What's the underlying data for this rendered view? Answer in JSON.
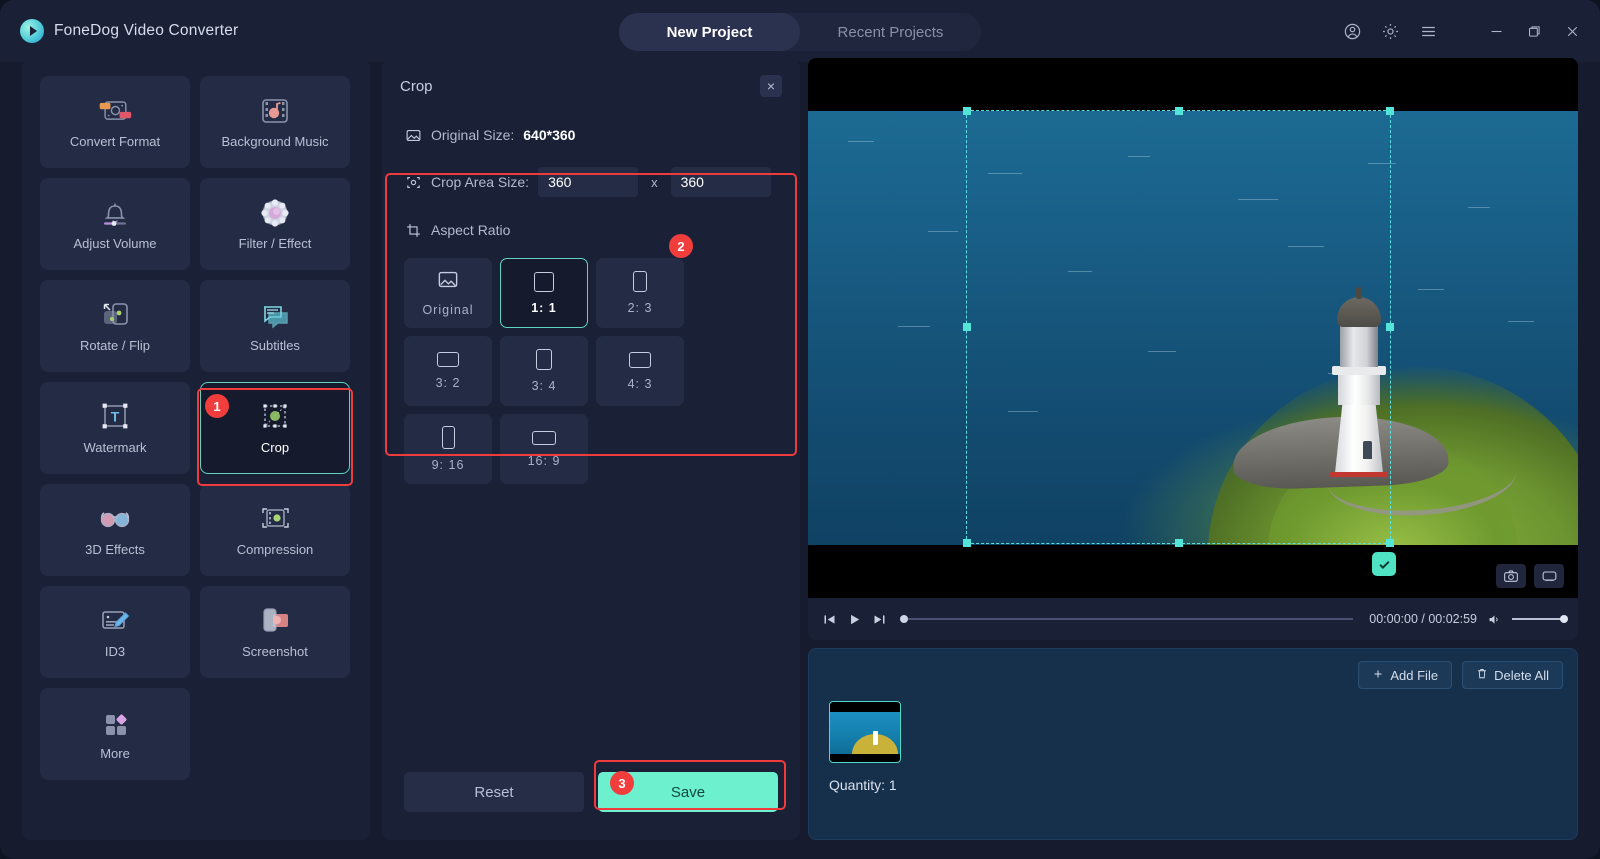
{
  "app": {
    "brand": "FoneDog Video Converter",
    "logo_icon": "play-circle-icon"
  },
  "header": {
    "tabs": [
      {
        "label": "New Project",
        "active": true
      },
      {
        "label": "Recent Projects",
        "active": false
      }
    ],
    "icons": [
      {
        "name": "account-icon"
      },
      {
        "name": "gear-icon"
      },
      {
        "name": "menu-icon"
      },
      {
        "name": "minimize-icon"
      },
      {
        "name": "maximize-icon"
      },
      {
        "name": "close-icon"
      }
    ]
  },
  "sidebar": {
    "tools": [
      {
        "label": "Convert Format",
        "icon": "convert-format-icon",
        "selected": false
      },
      {
        "label": "Background Music",
        "icon": "background-music-icon",
        "selected": false
      },
      {
        "label": "Adjust Volume",
        "icon": "adjust-volume-icon",
        "selected": false
      },
      {
        "label": "Filter / Effect",
        "icon": "filter-effect-icon",
        "selected": false
      },
      {
        "label": "Rotate / Flip",
        "icon": "rotate-flip-icon",
        "selected": false
      },
      {
        "label": "Subtitles",
        "icon": "subtitles-icon",
        "selected": false
      },
      {
        "label": "Watermark",
        "icon": "watermark-icon",
        "selected": false
      },
      {
        "label": "Crop",
        "icon": "crop-icon",
        "selected": true
      },
      {
        "label": "3D Effects",
        "icon": "3d-effects-icon",
        "selected": false
      },
      {
        "label": "Compression",
        "icon": "compression-icon",
        "selected": false
      },
      {
        "label": "ID3",
        "icon": "id3-icon",
        "selected": false
      },
      {
        "label": "Screenshot",
        "icon": "screenshot-icon",
        "selected": false
      },
      {
        "label": "More",
        "icon": "more-icon",
        "selected": false
      }
    ]
  },
  "crop_panel": {
    "title": "Crop",
    "close_label": "×",
    "original_size_label": "Original Size:",
    "original_size_value": "640*360",
    "crop_area_label": "Crop Area Size:",
    "crop_width": "360",
    "crop_height": "360",
    "x_separator": "x",
    "aspect_ratio_label": "Aspect Ratio",
    "aspect_ratios": [
      {
        "label": "Original",
        "shape": "image",
        "selected": false
      },
      {
        "label": "1: 1",
        "shape": "square",
        "selected": true
      },
      {
        "label": "2: 3",
        "shape": "portrait-2-3",
        "selected": false
      },
      {
        "label": "3: 2",
        "shape": "landscape-3-2",
        "selected": false
      },
      {
        "label": "3: 4",
        "shape": "portrait-3-4",
        "selected": false
      },
      {
        "label": "4: 3",
        "shape": "landscape-4-3",
        "selected": false
      },
      {
        "label": "9: 16",
        "shape": "portrait-9-16",
        "selected": false
      },
      {
        "label": "16: 9",
        "shape": "landscape-16-9",
        "selected": false
      }
    ],
    "reset_label": "Reset",
    "save_label": "Save"
  },
  "preview": {
    "snapshot_icon": "camera-icon",
    "fullscreen_icon": "screen-icon",
    "check_icon": "check-icon",
    "player": {
      "prev_icon": "skip-previous-icon",
      "play_icon": "play-icon",
      "next_icon": "skip-next-icon",
      "timecode": "00:00:00 / 00:02:59",
      "volume_icon": "volume-icon",
      "progress_percent": 0,
      "volume_percent": 100
    }
  },
  "file_list": {
    "add_file_label": "Add File",
    "add_file_icon": "plus-icon",
    "delete_all_label": "Delete All",
    "delete_all_icon": "trash-icon",
    "quantity_label": "Quantity: 1"
  },
  "annotations": [
    {
      "number": "1",
      "target": "crop-tool-tile"
    },
    {
      "number": "2",
      "target": "crop-settings-group"
    },
    {
      "number": "3",
      "target": "save-button"
    }
  ],
  "colors": {
    "accent_mint": "#6cf0ce",
    "accent_teal": "#5fd3c0",
    "annotation_red": "#ef3b3b",
    "panel_bg": "#1a2036",
    "tile_bg": "#242b44",
    "window_bg": "#161c2e",
    "filelist_bg": "#16304b"
  }
}
